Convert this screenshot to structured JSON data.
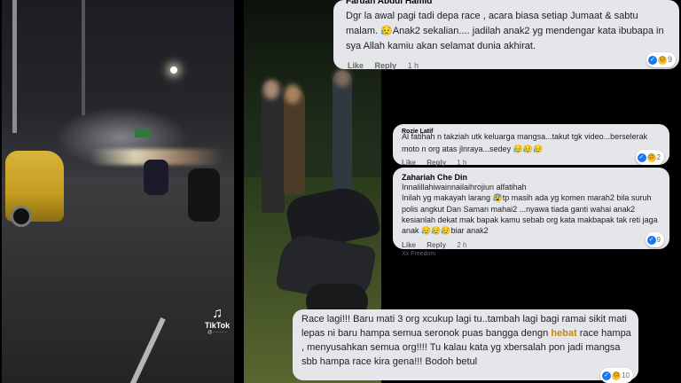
{
  "video": {
    "watermark_brand": "TikTok",
    "watermark_handle": "@··········"
  },
  "comments": [
    {
      "name": "Fardan Abdul Hamid",
      "text": "Dgr la awal pagi tadi depa race , acara biasa setiap Jumaat & sabtu malam. 😥Anak2 sekalian.... jadilah anak2 yg mendengar kata ibubapa in sya Allah kamiu akan selamat dunia akhirat.",
      "like_label": "Like",
      "reply_label": "Reply",
      "time": "1 h",
      "reaction_count": "9"
    },
    {
      "name": "Rozie Latif",
      "text": "Al fatihah n takziah utk keluarga mangsa...takut tgk video...berselerak moto n org atas jlnraya...sedey 😥😥😥",
      "like_label": "Like",
      "reply_label": "Reply",
      "time": "1 h",
      "reaction_count": "2"
    },
    {
      "name": "Zahariah Che Din",
      "text": "Innalillahiwainnailaihrojiun alfatihah\nInilah yg makayah larang 😰tp masih ada yg komen marah2 bila suruh polis angkut Dan Saman mahai2 ...nyawa tiada ganti wahai anak2 kesianlah dekat mak bapak kamu sebab org kata makbapak tak reti jaga anak 😥😥😥biar anak2",
      "like_label": "Like",
      "reply_label": "Reply",
      "time": "2 h",
      "reaction_count": "9"
    },
    {
      "name": "Xx Freedom"
    },
    {
      "text_before": "Race lagi!!! Baru mati 3 org xcukup lagi tu..tambah lagi bagi ramai sikit mati lepas ni baru hampa semua seronok puas bangga dengn ",
      "highlight": "hebat",
      "text_after": " race hampa , menyusahkan semua org!!!! Tu kalau kata yg xbersalah pon jadi mangsa sbb hampa race kira gena!!! Bodoh betul",
      "reaction_count": "10"
    }
  ],
  "colors": {
    "card_bg": "#e4e6ea",
    "like_blue": "#1877f2",
    "meta_gray": "#65676b",
    "highlight": "#c8860d"
  }
}
